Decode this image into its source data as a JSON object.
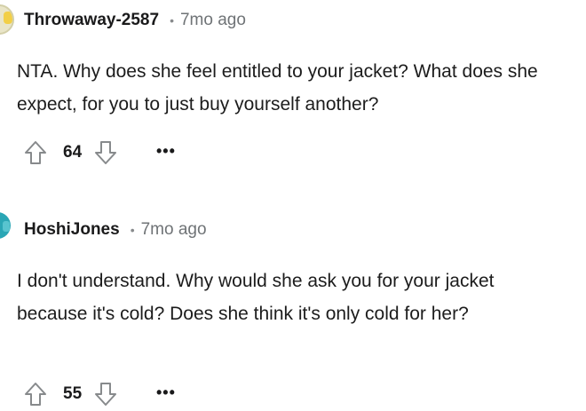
{
  "comments": [
    {
      "username": "Throwaway-2587",
      "separator": "•",
      "time": "7mo ago",
      "body": "NTA. Why does she feel entitled to your jacket? What does she expect, for you to just buy yourself another?",
      "score": "64",
      "more_label": "•••"
    },
    {
      "username": "HoshiJones",
      "separator": "•",
      "time": "7mo ago",
      "body": "I don't understand. Why would she ask you for your jacket because it's cold? Does she think it's only cold for her?",
      "score": "55",
      "more_label": "•••"
    }
  ],
  "icons": {
    "upvote": "upvote-arrow-icon",
    "downvote": "downvote-arrow-icon",
    "more": "more-options-icon"
  },
  "colors": {
    "username": "#1a1a1b",
    "meta": "#6f7376",
    "icon_stroke": "#878a8c"
  }
}
